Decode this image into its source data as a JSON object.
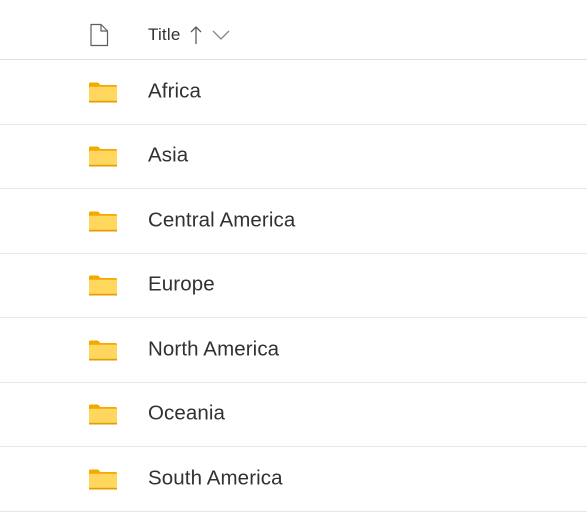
{
  "header": {
    "title_column_label": "Title",
    "sort_direction": "ascending",
    "file_type_icon": "document-icon",
    "sort_icon": "arrow-up-icon",
    "menu_icon": "chevron-down-icon"
  },
  "colors": {
    "folder_body": "#ffd75e",
    "folder_tab": "#f2a900",
    "folder_shadow": "#e69c00",
    "divider": "#e1dfdd",
    "text": "#323130"
  },
  "rows": [
    {
      "label": "Africa",
      "icon": "folder-icon"
    },
    {
      "label": "Asia",
      "icon": "folder-icon"
    },
    {
      "label": "Central America",
      "icon": "folder-icon"
    },
    {
      "label": "Europe",
      "icon": "folder-icon"
    },
    {
      "label": "North America",
      "icon": "folder-icon"
    },
    {
      "label": "Oceania",
      "icon": "folder-icon"
    },
    {
      "label": "South America",
      "icon": "folder-icon"
    }
  ]
}
